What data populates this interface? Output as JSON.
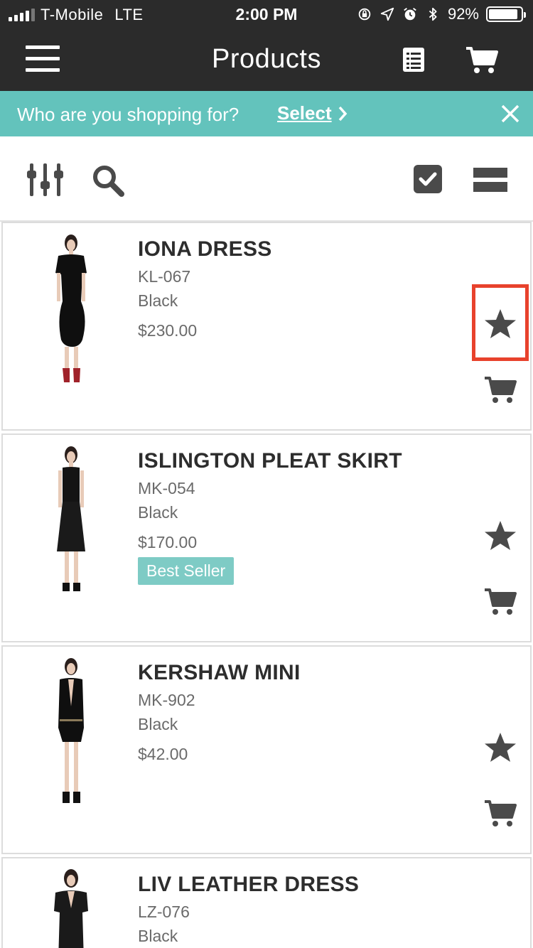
{
  "status_bar": {
    "carrier": "T-Mobile",
    "network": "LTE",
    "time": "2:00 PM",
    "battery": "92%",
    "battery_level": 0.92
  },
  "nav": {
    "title": "Products"
  },
  "banner": {
    "text": "Who are you shopping for?",
    "select_label": "Select"
  },
  "products": [
    {
      "name": "IONA DRESS",
      "sku": "KL-067",
      "color": "Black",
      "price": "$230.00",
      "badge": ""
    },
    {
      "name": "ISLINGTON PLEAT SKIRT",
      "sku": "MK-054",
      "color": "Black",
      "price": "$170.00",
      "badge": "Best Seller"
    },
    {
      "name": "KERSHAW MINI",
      "sku": "MK-902",
      "color": "Black",
      "price": "$42.00",
      "badge": ""
    },
    {
      "name": "LIV LEATHER DRESS",
      "sku": "LZ-076",
      "color": "Black",
      "price": "",
      "badge": ""
    }
  ],
  "colors": {
    "nav_bg": "#2b2b2b",
    "banner_bg": "#63c3bc",
    "badge_bg": "#7ecbc5",
    "icon_gray": "#4a4a4a",
    "highlight": "#e8422c"
  }
}
